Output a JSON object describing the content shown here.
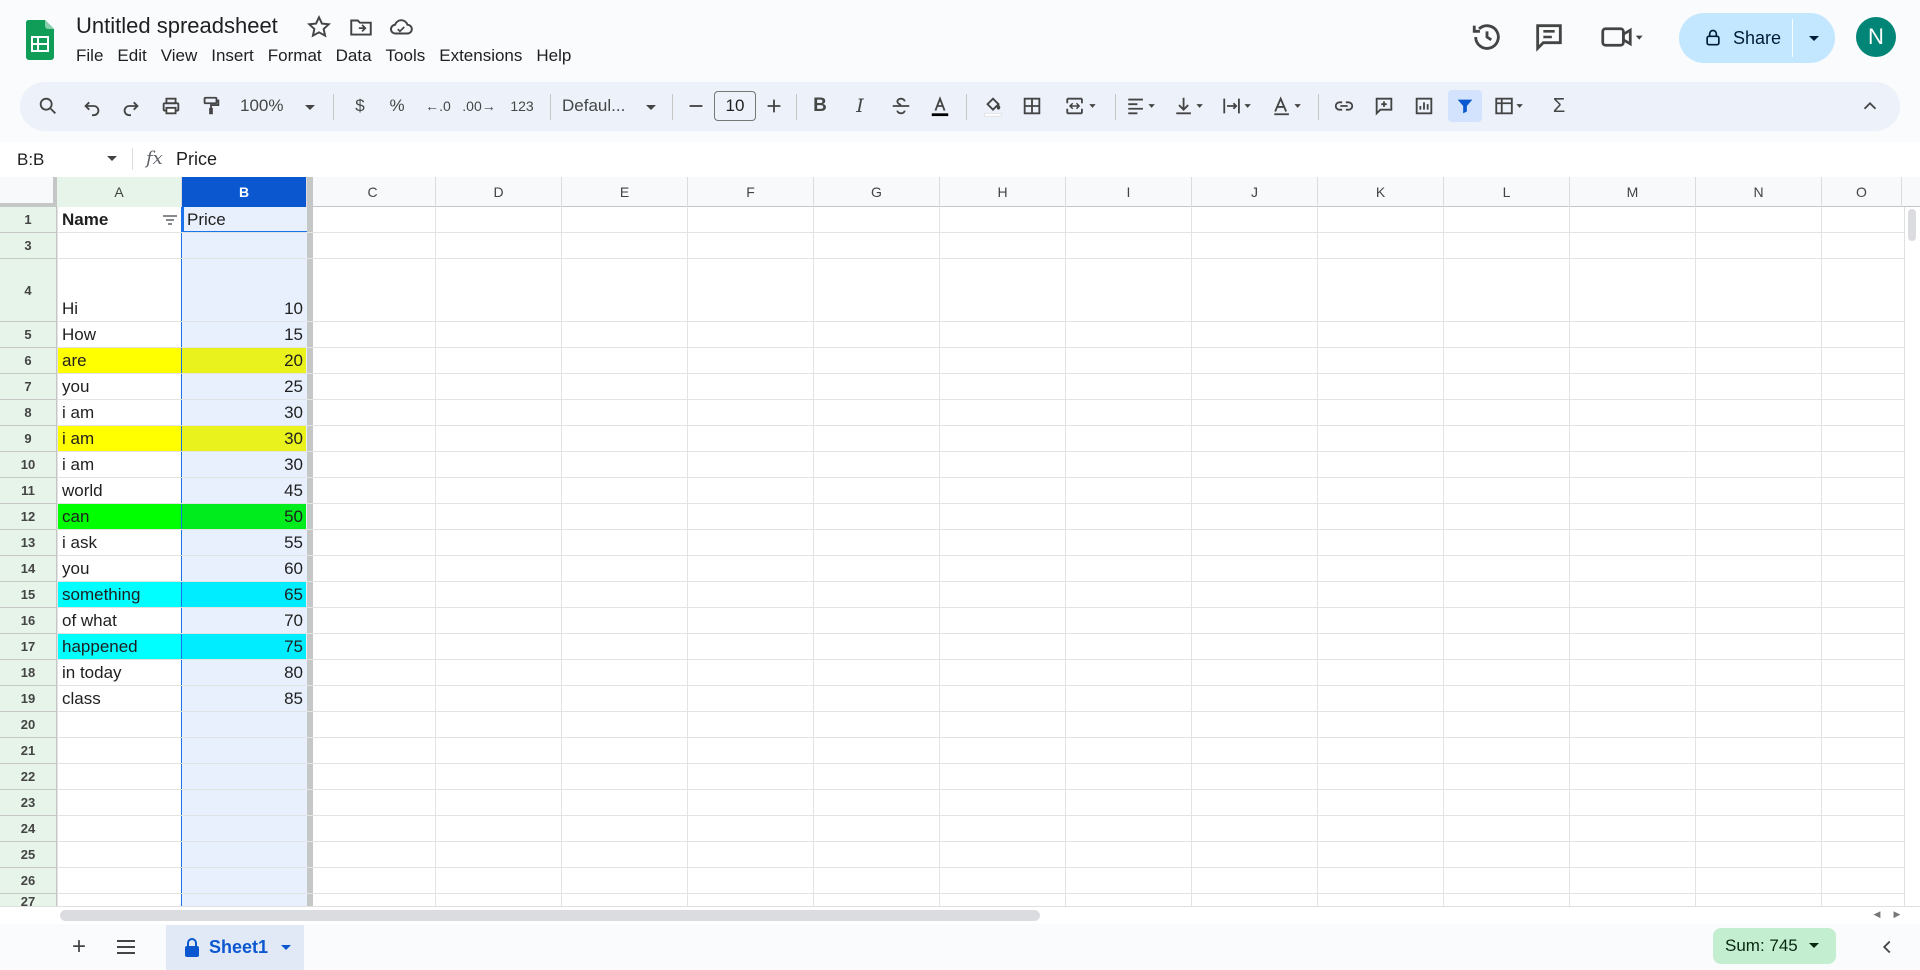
{
  "app": {
    "title": "Untitled spreadsheet",
    "avatar_letter": "N",
    "share_label": "Share"
  },
  "menu": [
    "File",
    "Edit",
    "View",
    "Insert",
    "Format",
    "Data",
    "Tools",
    "Extensions",
    "Help"
  ],
  "toolbar": {
    "zoom": "100%",
    "currency": "$",
    "percent": "%",
    "number_format": "123",
    "font": "Defaul...",
    "font_size": "10"
  },
  "formula_bar": {
    "name_box": "B:B",
    "fx": "fx",
    "content": "Price"
  },
  "columns": [
    "A",
    "B",
    "C",
    "D",
    "E",
    "F",
    "G",
    "H",
    "I",
    "J",
    "K",
    "L",
    "M",
    "N",
    "O"
  ],
  "rows": [
    {
      "num": "1",
      "a": "Name",
      "b": "Price",
      "fill": ""
    },
    {
      "num": "3",
      "a": "",
      "b": "",
      "fill": ""
    },
    {
      "num": "4",
      "a": "Hi",
      "b": "10",
      "fill": ""
    },
    {
      "num": "5",
      "a": "How",
      "b": "15",
      "fill": ""
    },
    {
      "num": "6",
      "a": "are",
      "b": "20",
      "fill": "#ffff00"
    },
    {
      "num": "7",
      "a": "you",
      "b": "25",
      "fill": ""
    },
    {
      "num": "8",
      "a": "i am",
      "b": "30",
      "fill": ""
    },
    {
      "num": "9",
      "a": "i am",
      "b": "30",
      "fill": "#ffff00"
    },
    {
      "num": "10",
      "a": "i am",
      "b": "30",
      "fill": ""
    },
    {
      "num": "11",
      "a": "world",
      "b": "45",
      "fill": ""
    },
    {
      "num": "12",
      "a": "can",
      "b": "50",
      "fill": "#00ff00"
    },
    {
      "num": "13",
      "a": "i ask",
      "b": "55",
      "fill": ""
    },
    {
      "num": "14",
      "a": "you",
      "b": "60",
      "fill": ""
    },
    {
      "num": "15",
      "a": "something",
      "b": "65",
      "fill": "#00ffff"
    },
    {
      "num": "16",
      "a": "of what",
      "b": "70",
      "fill": ""
    },
    {
      "num": "17",
      "a": "happened",
      "b": "75",
      "fill": "#00ffff"
    },
    {
      "num": "18",
      "a": "in today",
      "b": "80",
      "fill": ""
    },
    {
      "num": "19",
      "a": "class",
      "b": "85",
      "fill": ""
    },
    {
      "num": "20",
      "a": "",
      "b": "",
      "fill": ""
    },
    {
      "num": "21",
      "a": "",
      "b": "",
      "fill": ""
    },
    {
      "num": "22",
      "a": "",
      "b": "",
      "fill": ""
    },
    {
      "num": "23",
      "a": "",
      "b": "",
      "fill": ""
    },
    {
      "num": "24",
      "a": "",
      "b": "",
      "fill": ""
    },
    {
      "num": "25",
      "a": "",
      "b": "",
      "fill": ""
    },
    {
      "num": "26",
      "a": "",
      "b": "",
      "fill": ""
    },
    {
      "num": "27",
      "a": "",
      "b": "",
      "fill": ""
    }
  ],
  "sheet": {
    "tab_name": "Sheet1"
  },
  "status": {
    "sum": "Sum: 745"
  },
  "colors": {
    "selected_col_header": "#0b57d0",
    "selected_col_fill": "#e8f0fe",
    "row_header_selected": "#e6f4ea"
  }
}
